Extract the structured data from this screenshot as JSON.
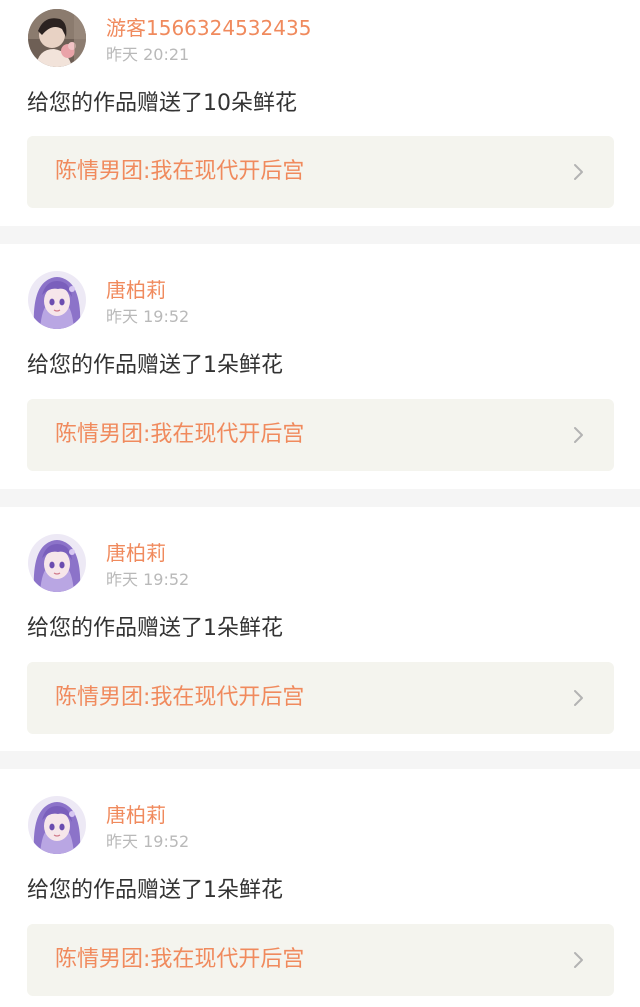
{
  "colors": {
    "accent": "#f08a5d",
    "time": "#b9b9b9",
    "text": "#333333",
    "link_bg": "#f4f4ee",
    "separator": "#f5f5f5"
  },
  "notifications": [
    {
      "username": "游客1566324532435",
      "time": "昨天 20:21",
      "message": "给您的作品赠送了10朵鲜花",
      "work_title": "陈情男团:我在现代开后宫",
      "avatar_icon": "user-avatar-photo"
    },
    {
      "username": "唐柏莉",
      "time": "昨天 19:52",
      "message": "给您的作品赠送了1朵鲜花",
      "work_title": "陈情男团:我在现代开后宫",
      "avatar_icon": "anime-girl-avatar"
    },
    {
      "username": "唐柏莉",
      "time": "昨天 19:52",
      "message": "给您的作品赠送了1朵鲜花",
      "work_title": "陈情男团:我在现代开后宫",
      "avatar_icon": "anime-girl-avatar"
    },
    {
      "username": "唐柏莉",
      "time": "昨天 19:52",
      "message": "给您的作品赠送了1朵鲜花",
      "work_title": "陈情男团:我在现代开后宫",
      "avatar_icon": "anime-girl-avatar"
    }
  ]
}
